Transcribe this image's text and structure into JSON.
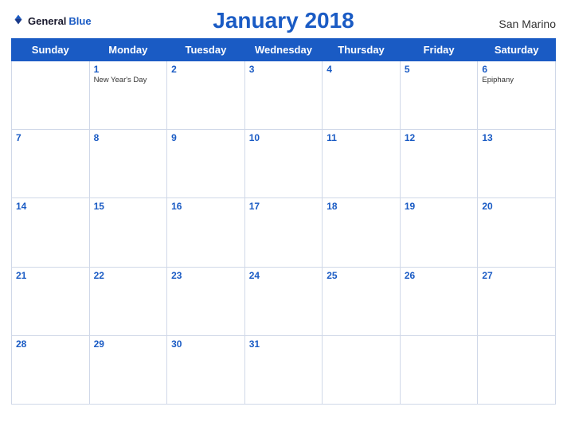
{
  "header": {
    "logo": {
      "general": "General",
      "blue": "Blue",
      "bird_unicode": "🔵"
    },
    "title": "January 2018",
    "country": "San Marino"
  },
  "weekdays": [
    "Sunday",
    "Monday",
    "Tuesday",
    "Wednesday",
    "Thursday",
    "Friday",
    "Saturday"
  ],
  "weeks": [
    [
      {
        "day": "",
        "holiday": ""
      },
      {
        "day": "1",
        "holiday": "New Year's Day"
      },
      {
        "day": "2",
        "holiday": ""
      },
      {
        "day": "3",
        "holiday": ""
      },
      {
        "day": "4",
        "holiday": ""
      },
      {
        "day": "5",
        "holiday": ""
      },
      {
        "day": "6",
        "holiday": "Epiphany"
      }
    ],
    [
      {
        "day": "7",
        "holiday": ""
      },
      {
        "day": "8",
        "holiday": ""
      },
      {
        "day": "9",
        "holiday": ""
      },
      {
        "day": "10",
        "holiday": ""
      },
      {
        "day": "11",
        "holiday": ""
      },
      {
        "day": "12",
        "holiday": ""
      },
      {
        "day": "13",
        "holiday": ""
      }
    ],
    [
      {
        "day": "14",
        "holiday": ""
      },
      {
        "day": "15",
        "holiday": ""
      },
      {
        "day": "16",
        "holiday": ""
      },
      {
        "day": "17",
        "holiday": ""
      },
      {
        "day": "18",
        "holiday": ""
      },
      {
        "day": "19",
        "holiday": ""
      },
      {
        "day": "20",
        "holiday": ""
      }
    ],
    [
      {
        "day": "21",
        "holiday": ""
      },
      {
        "day": "22",
        "holiday": ""
      },
      {
        "day": "23",
        "holiday": ""
      },
      {
        "day": "24",
        "holiday": ""
      },
      {
        "day": "25",
        "holiday": ""
      },
      {
        "day": "26",
        "holiday": ""
      },
      {
        "day": "27",
        "holiday": ""
      }
    ],
    [
      {
        "day": "28",
        "holiday": ""
      },
      {
        "day": "29",
        "holiday": ""
      },
      {
        "day": "30",
        "holiday": ""
      },
      {
        "day": "31",
        "holiday": ""
      },
      {
        "day": "",
        "holiday": ""
      },
      {
        "day": "",
        "holiday": ""
      },
      {
        "day": "",
        "holiday": ""
      }
    ]
  ],
  "colors": {
    "blue": "#1a5bc4",
    "header_bg": "#1a5bc4",
    "white": "#ffffff"
  }
}
